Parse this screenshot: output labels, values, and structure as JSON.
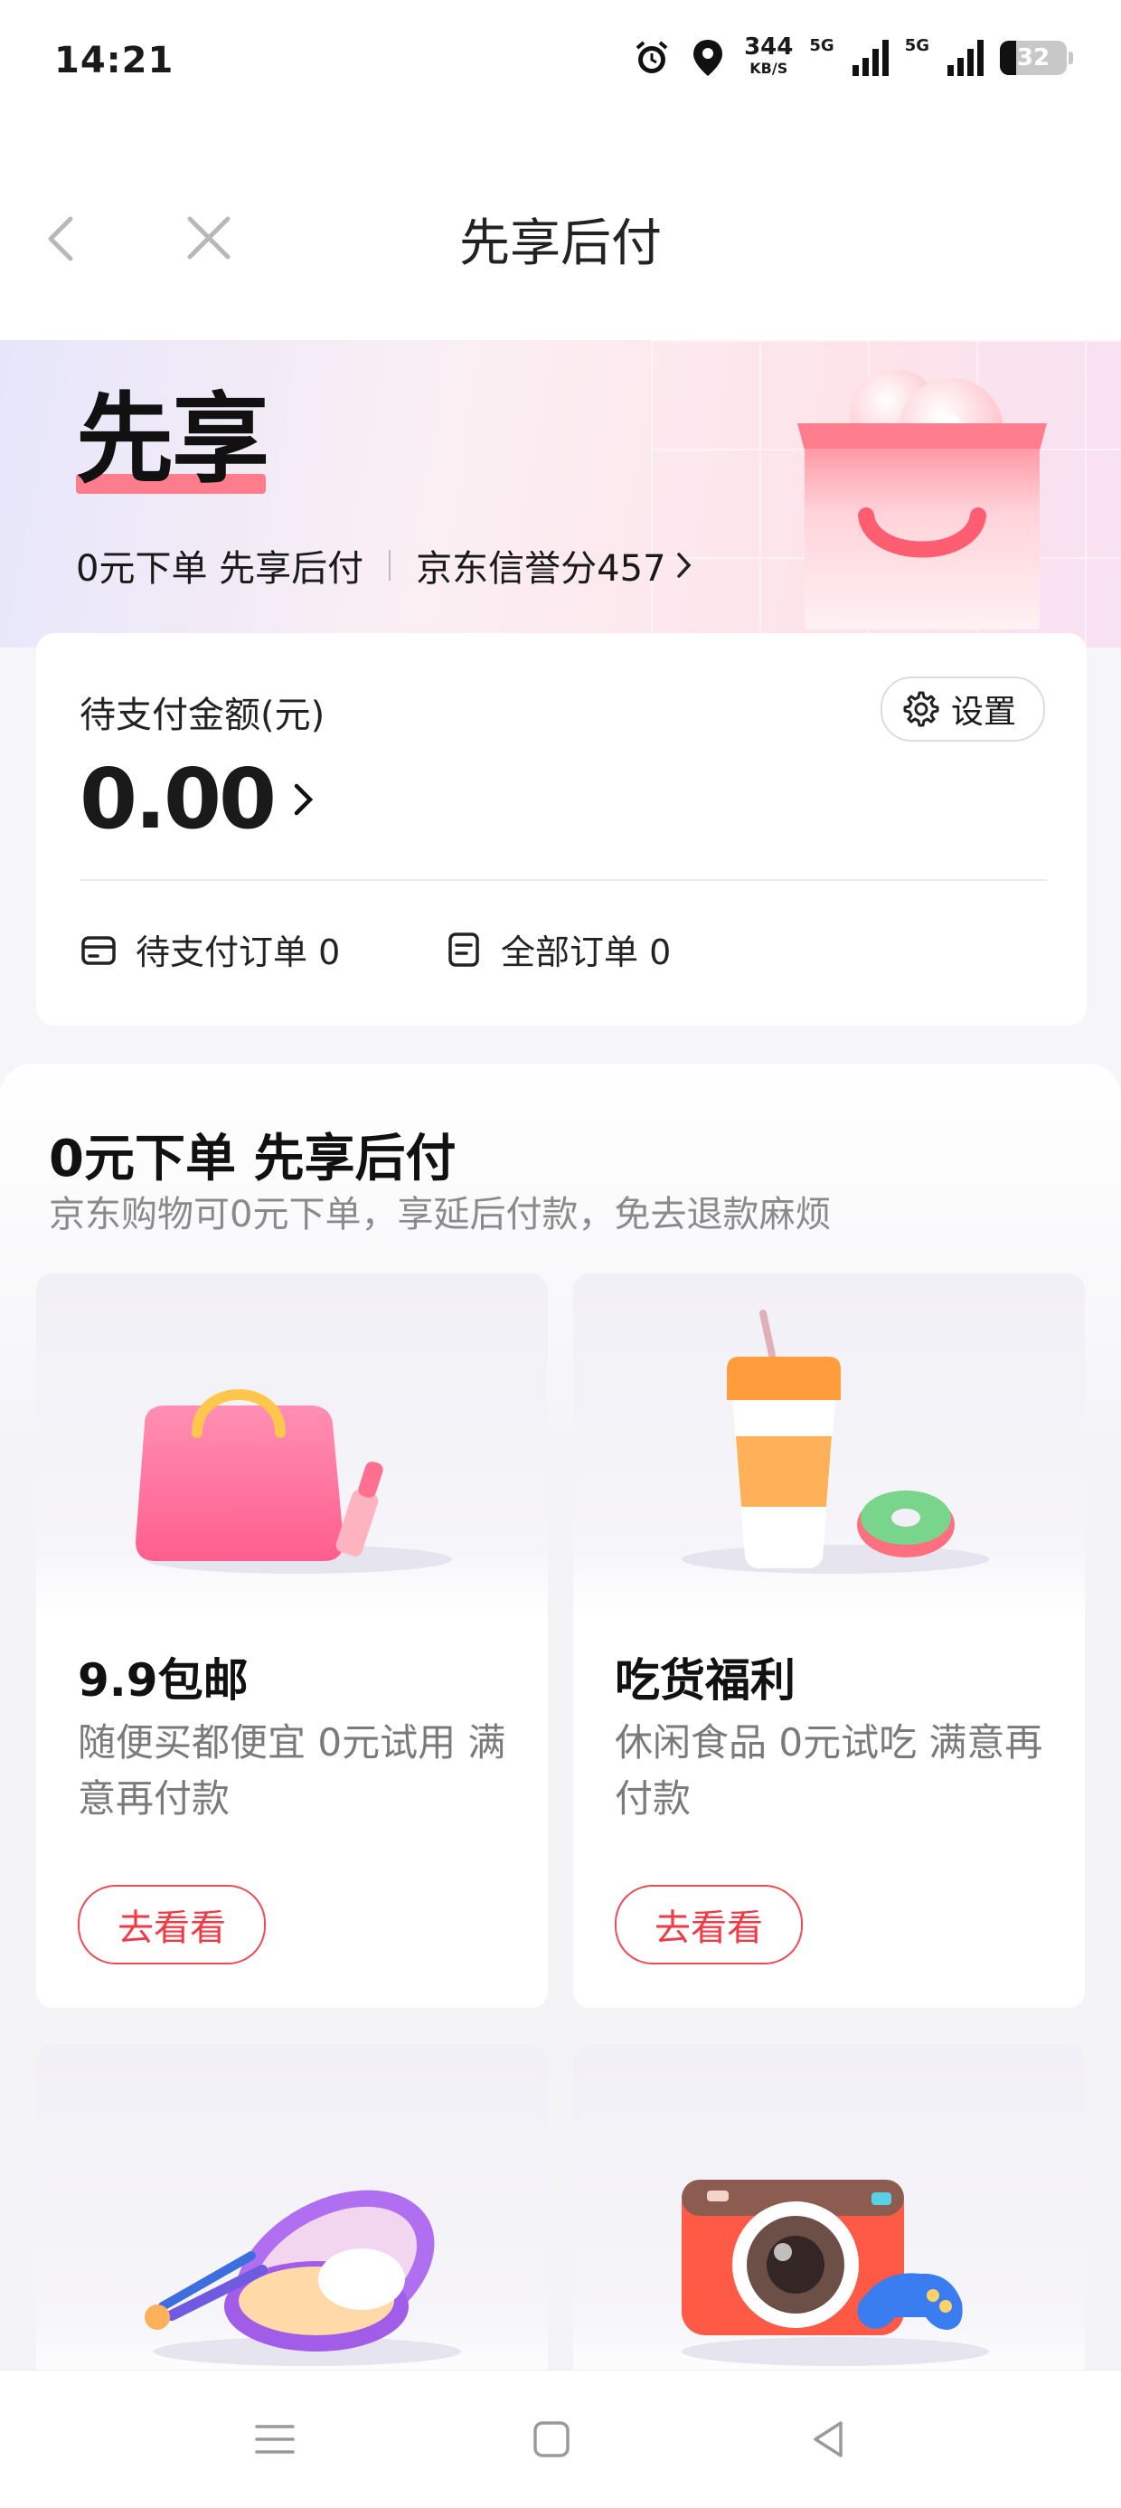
{
  "status_bar": {
    "time": "14:21",
    "net_speed_value": "344",
    "net_speed_unit": "KB/S",
    "signal_1_label": "5G",
    "signal_2_label": "5G",
    "battery": "32"
  },
  "nav": {
    "title": "先享后付",
    "back_icon": "chevron-left-icon",
    "close_icon": "close-icon"
  },
  "hero": {
    "title": "先享",
    "slogan": "0元下单 先享后付",
    "credit_score": "京东信誉分457"
  },
  "pay_card": {
    "label": "待支付金额(元)",
    "amount": "0.00",
    "settings_label": "设置",
    "pending_orders": "待支付订单 0",
    "all_orders": "全部订单 0"
  },
  "promo": {
    "title": "0元下单 先享后付",
    "subtitle": "京东购物可0元下单，享延后付款，免去退款麻烦",
    "tiles": [
      {
        "title": "9.9包邮",
        "desc": "随便买都便宜 0元试用 满意再付款",
        "button": "去看看",
        "icon": "shopping-bag-icon"
      },
      {
        "title": "吃货福利",
        "desc": "休闲食品 0元试吃 满意再付款",
        "button": "去看看",
        "icon": "coffee-cup-icon"
      },
      {
        "icon": "cosmetics-compact-icon"
      },
      {
        "icon": "camera-icon"
      }
    ]
  },
  "colors": {
    "accent_red": "#ef3b45",
    "hero_underline": "#ff6a7a",
    "text_primary": "#111111",
    "text_secondary": "#7a7a7a"
  }
}
